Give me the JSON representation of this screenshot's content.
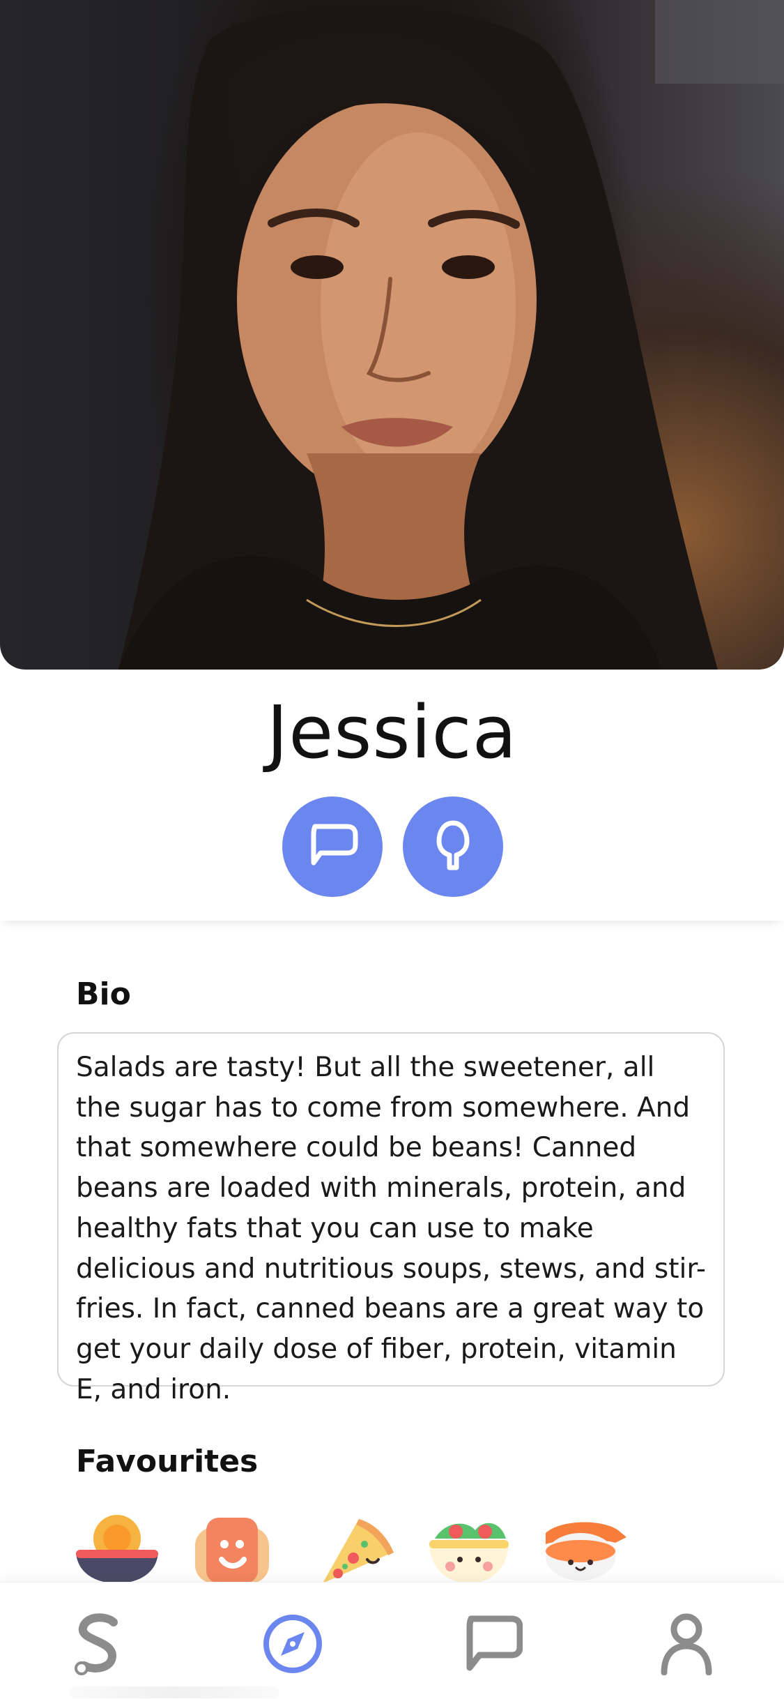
{
  "profile": {
    "name": "Jessica",
    "photo_alt": "profile photo"
  },
  "actions": {
    "message_icon": "chat-bubble-icon",
    "spoon_icon": "spoon-icon"
  },
  "bio": {
    "title": "Bio",
    "text": "Salads are tasty! But all the sweetener, all the sugar has to come from somewhere. And that somewhere could be beans! Canned beans are loaded with minerals, protein, and healthy fats that you can use to make delicious and nutritious soups, stews, and stir-fries. In fact, canned beans are a great way to get your daily dose of fiber, protein, vitamin E, and iron."
  },
  "favourites": {
    "title": "Favourites",
    "items": [
      "noodle-bowl-icon",
      "waffle-icon",
      "pizza-slice-icon",
      "salad-bowl-icon",
      "sushi-icon"
    ]
  },
  "nav": {
    "items": [
      "logo-icon",
      "compass-icon",
      "chat-icon",
      "profile-icon"
    ],
    "active": "compass-icon"
  },
  "colors": {
    "accent": "#6b86ee",
    "nav_inactive": "#8c8c8c"
  }
}
